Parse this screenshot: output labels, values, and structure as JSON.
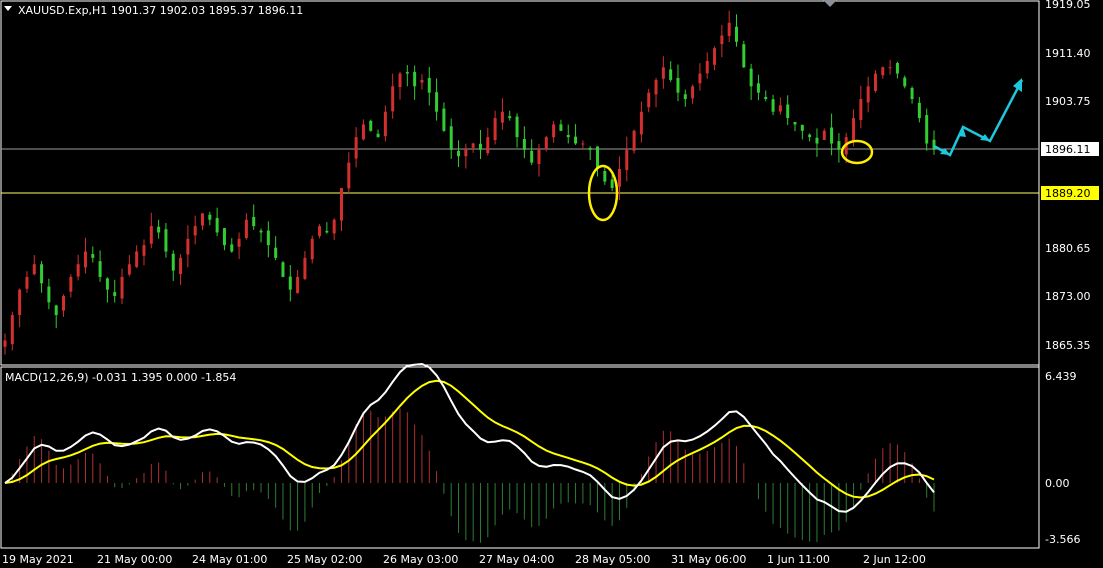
{
  "chart": {
    "symbol_header": "XAUUSD.Exp,H1  1901.37 1902.03 1895.37 1896.11",
    "macd_header": "MACD(12,26,9) -0.031 1.395 0.000 -1.854",
    "price_labels": [
      "1919.05",
      "1911.40",
      "1903.75",
      "1896.11",
      "1889.20",
      "1880.65",
      "1873.00",
      "1865.35"
    ],
    "current_price_label": "1896.11",
    "level_label": "1889.20",
    "macd_labels": [
      "6.439",
      "0.00",
      "-3.566"
    ],
    "time_labels": [
      "19 May 2021",
      "21 May 00:00",
      "24 May 01:00",
      "25 May 02:00",
      "26 May 03:00",
      "27 May 04:00",
      "28 May 05:00",
      "31 May 06:00",
      "1 Jun 11:00",
      "2 Jun 12:00"
    ],
    "colors": {
      "bull": "#d32f2f",
      "bear": "#32cd32",
      "macd_line": "#ffffff",
      "signal_line": "#ffff00",
      "hist_pos": "#b03030",
      "hist_neg": "#2e7d32",
      "arrow": "#1ec8dc",
      "ellipse": "#ffee00",
      "hline": "#9e9e9e",
      "level_line": "#ffff66"
    }
  },
  "chart_data": [
    {
      "type": "candlestick",
      "title": "XAUUSD.Exp,H1",
      "ohlc_last": {
        "open": 1901.37,
        "high": 1902.03,
        "low": 1895.37,
        "close": 1896.11
      },
      "ylim": [
        1862.0,
        1920.0
      ],
      "close_series": [
        1866,
        1870,
        1874,
        1876,
        1878,
        1875,
        1872,
        1870,
        1873,
        1876,
        1878,
        1880,
        1879,
        1876,
        1874,
        1873,
        1876,
        1878,
        1880,
        1881,
        1884,
        1883,
        1880,
        1877,
        1879,
        1882,
        1884,
        1886,
        1885,
        1883,
        1881,
        1880,
        1882,
        1885,
        1884,
        1883,
        1881,
        1879,
        1876,
        1874,
        1876,
        1879,
        1882,
        1884,
        1883,
        1885,
        1890,
        1894,
        1898,
        1900,
        1899,
        1898,
        1902,
        1906,
        1908,
        1908,
        1906,
        1907,
        1905,
        1902,
        1899,
        1896,
        1895,
        1896,
        1897,
        1896,
        1898,
        1901,
        1902,
        1901,
        1898,
        1896,
        1894,
        1896,
        1898,
        1900,
        1899,
        1898,
        1897,
        1897,
        1896,
        1893,
        1891,
        1890,
        1893,
        1896,
        1899,
        1902,
        1905,
        1907,
        1909,
        1907,
        1905,
        1904,
        1906,
        1908,
        1910,
        1912,
        1914,
        1916,
        1913,
        1909,
        1906,
        1905,
        1904,
        1902,
        1903,
        1901,
        1900,
        1899,
        1898,
        1897,
        1899,
        1897,
        1896,
        1898,
        1901,
        1904,
        1906,
        1908,
        1909,
        1909,
        1908,
        1906,
        1904,
        1901,
        1897,
        1896
      ]
    },
    {
      "type": "line",
      "title": "MACD(12,26,9)",
      "macd_value": -0.031,
      "signal_value": 1.395,
      "ylim": [
        -3.566,
        6.439
      ]
    }
  ]
}
